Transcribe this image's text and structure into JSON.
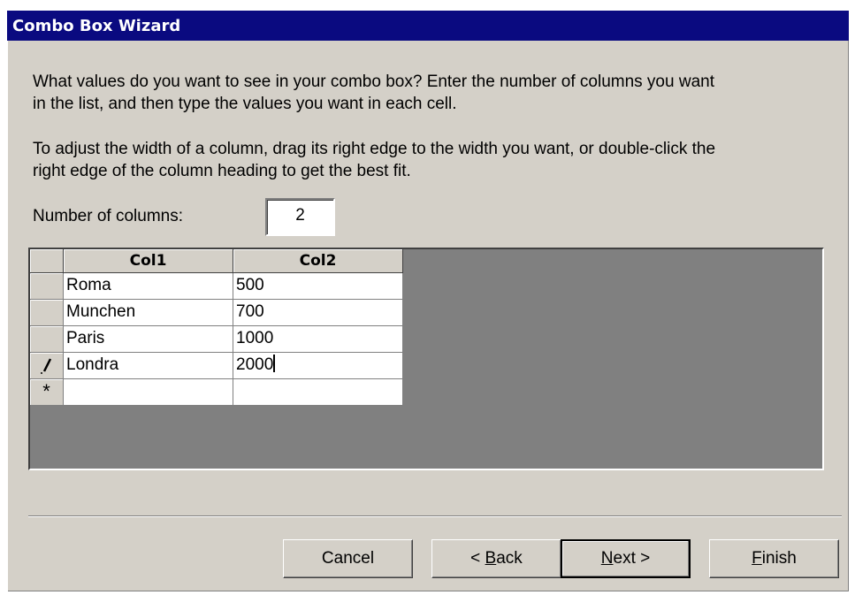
{
  "window": {
    "title": "Combo Box Wizard"
  },
  "instructions": {
    "line1": "What values do you want to see in your combo box? Enter the number of columns you want",
    "line2": "in the list, and then type the values you want in each cell.",
    "line3": "To adjust the width of a column, drag its right edge to the width you want, or double-click the",
    "line4": "right edge of the column heading to get the best fit."
  },
  "columns_field": {
    "label": "Number of columns:",
    "value": "2"
  },
  "grid": {
    "headers": [
      "Col1",
      "Col2"
    ],
    "rows": [
      {
        "col1": "Roma",
        "col2": "500",
        "selector": ""
      },
      {
        "col1": "Munchen",
        "col2": "700",
        "selector": ""
      },
      {
        "col1": "Paris",
        "col2": "1000",
        "selector": ""
      },
      {
        "col1": "Londra",
        "col2": "2000",
        "selector": "pencil-icon"
      }
    ],
    "new_row_selector": "*"
  },
  "buttons": {
    "cancel": "Cancel",
    "back_prefix": "< ",
    "back_mnemonic": "B",
    "back_rest": "ack",
    "next_mnemonic": "N",
    "next_rest": "ext >",
    "finish_mnemonic": "F",
    "finish_rest": "inish"
  },
  "colors": {
    "titlebar": "#0a0a80",
    "dialog": "#d4d0c8",
    "grid_background": "#808080"
  }
}
